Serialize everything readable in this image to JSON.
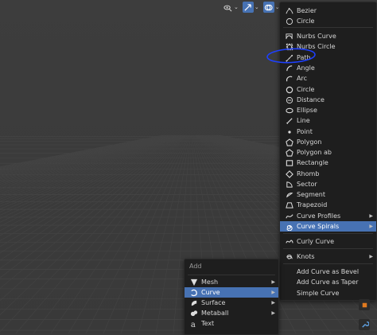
{
  "spiral_menu": {
    "items": [
      {
        "label": "Bezier",
        "icon": "bezier-curve-icon"
      },
      {
        "label": "Circle",
        "icon": "circle-outline-icon"
      },
      {
        "label": "Nurbs Curve",
        "icon": "nurbs-curve-icon"
      },
      {
        "label": "Nurbs Circle",
        "icon": "nurbs-circle-icon"
      },
      {
        "label": "Path",
        "icon": "path-icon"
      },
      {
        "label": "Angle",
        "icon": "angle-icon"
      },
      {
        "label": "Arc",
        "icon": "arc-icon"
      },
      {
        "label": "Circle",
        "icon": "circle-icon"
      },
      {
        "label": "Distance",
        "icon": "distance-icon"
      },
      {
        "label": "Ellipse",
        "icon": "ellipse-icon"
      },
      {
        "label": "Line",
        "icon": "line-icon"
      },
      {
        "label": "Point",
        "icon": "point-icon"
      },
      {
        "label": "Polygon",
        "icon": "polygon-icon"
      },
      {
        "label": "Polygon ab",
        "icon": "polygon-ab-icon"
      },
      {
        "label": "Rectangle",
        "icon": "rectangle-icon"
      },
      {
        "label": "Rhomb",
        "icon": "rhomb-icon"
      },
      {
        "label": "Sector",
        "icon": "sector-icon"
      },
      {
        "label": "Segment",
        "icon": "segment-icon"
      },
      {
        "label": "Trapezoid",
        "icon": "trapezoid-icon"
      },
      {
        "label": "Curve Profiles",
        "icon": "curve-profiles-icon"
      },
      {
        "label": "Curve Spirals",
        "icon": "curve-spirals-icon"
      },
      {
        "label": "Curly Curve",
        "icon": "curly-curve-icon"
      },
      {
        "label": "Knots",
        "icon": "knots-icon"
      },
      {
        "label": "Add Curve as Bevel",
        "icon": ""
      },
      {
        "label": "Add Curve as Taper",
        "icon": ""
      },
      {
        "label": "Simple Curve",
        "icon": ""
      }
    ]
  },
  "add_menu": {
    "title": "Add",
    "items": [
      {
        "label": "Mesh",
        "icon": "mesh-icon"
      },
      {
        "label": "Curve",
        "icon": "curve-icon"
      },
      {
        "label": "Surface",
        "icon": "surface-icon"
      },
      {
        "label": "Metaball",
        "icon": "metaball-icon"
      },
      {
        "label": "Text",
        "icon": "text-icon"
      }
    ]
  },
  "colors": {
    "highlight": "#4772b3",
    "annotation": "#1e40ff",
    "menu_bg": "#1e1e1e"
  }
}
